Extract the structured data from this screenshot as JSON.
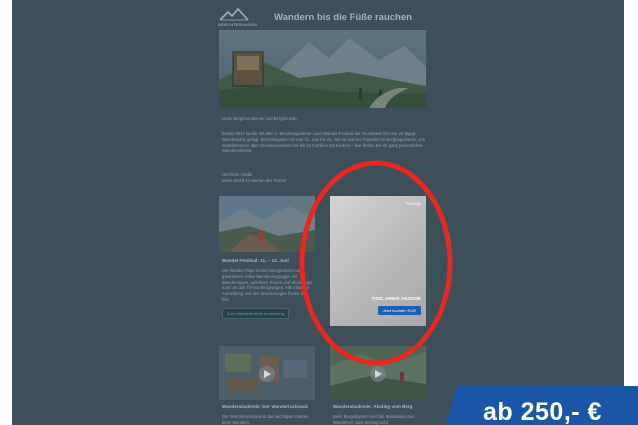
{
  "newsletter": {
    "logo_text": "BERCHTESGADEN",
    "title": "Wandern bis die Füße rauchen",
    "greeting": "Liebe Bergfreundinnen und Bergfreunde,",
    "intro": "bereits 2017 wurde mit dem 1. Berchtesgadener Land Wander-Festival der Grundstein für eine 20-tägige Wanderparty gelegt. Berchtesgaden ist vom 21. Juni bis 21. Juli ein wahres Paradies für Bergbegeisterte, von Gipfelstürmern über Genusswanderer bis hin zu Familien mit Kindern – hier finden Sie Ihr ganz persönliches Wandererlebnis.",
    "signature_line1": "Herzliche Grüße",
    "signature_line2": "Maria Sterzl im Namen des Teams"
  },
  "cards": [
    {
      "title": "Wander-Festival: 21. – 23. Juni",
      "text": "Die Wander-Tage im Berchtesgadener Land garantieren volles Wandervergnügen mit Wanderungen, geführten Touren und Workshops rund um das Thema Bergsteigen. Alle Infos zur Anmeldung und den Wanderungen finden Sie hier.",
      "button": "Zum Wanderfestival-Anmeldung"
    },
    {
      "title": "Wanderakademie: Der Wanderrucksack",
      "text": "Der Wanderrucksack ist das wichtigste Utensil beim Wandern."
    },
    {
      "title": "Wanderakademie: Abstieg vom Berg",
      "text": "Beim Bergabgehen wird die Muskulatur des Wanderers stark beansprucht."
    }
  ],
  "ad": {
    "label": "Anzeige",
    "title": "TITEL IHRER ANZEIGE",
    "button": "Jetzt buchen: EUR"
  },
  "overlay": {
    "price": "ab 250,- €",
    "price_color": "#1a56a8",
    "circle_color": "#e8281f"
  }
}
